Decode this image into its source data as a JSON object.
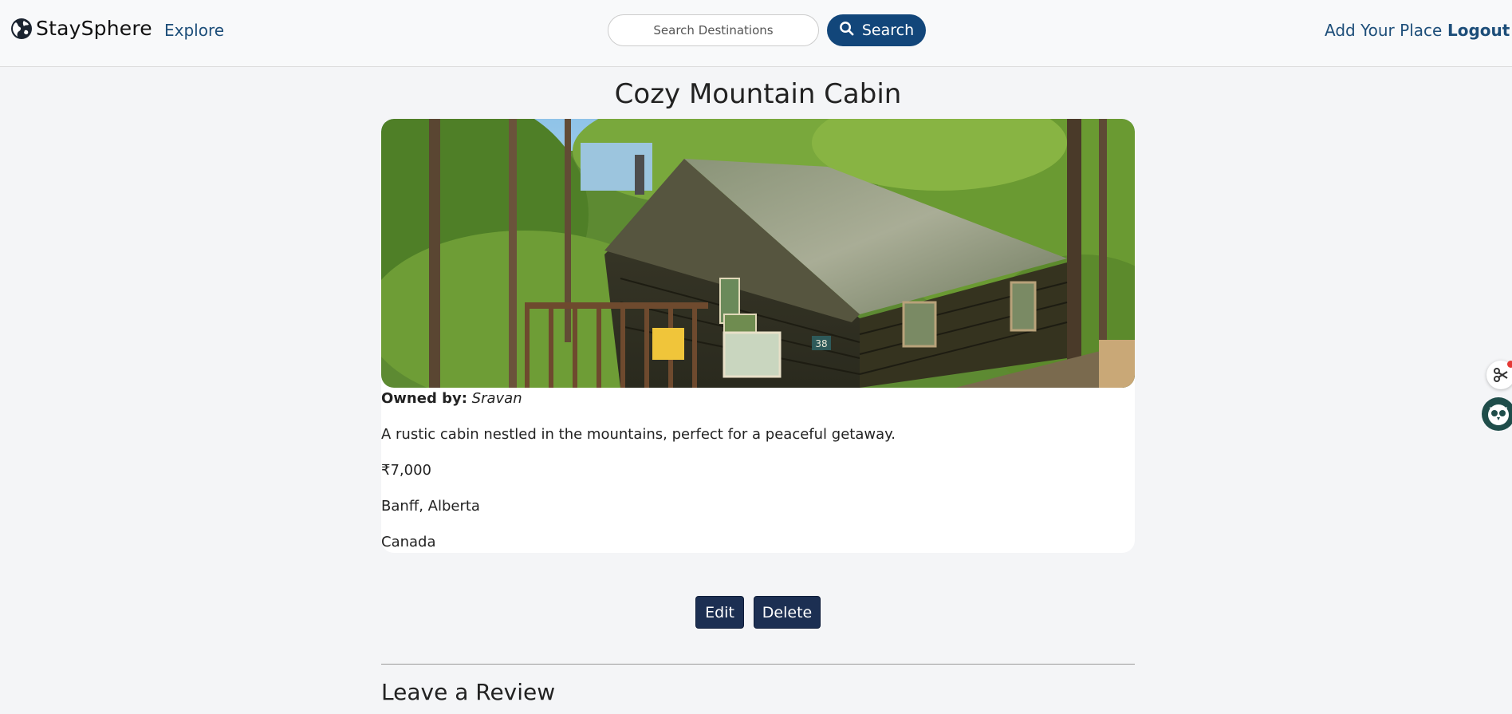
{
  "navbar": {
    "brand": "StaySphere",
    "explore": "Explore",
    "search_placeholder": "Search Destinations",
    "search_button": "Search",
    "add_place": "Add Your Place",
    "logout": "Logout"
  },
  "listing": {
    "title": "Cozy Mountain Cabin",
    "owned_label": "Owned by:",
    "owner": "Sravan",
    "description": "A rustic cabin nestled in the mountains, perfect for a peaceful getaway.",
    "price": "₹7,000",
    "location": "Banff, Alberta",
    "country": "Canada",
    "cabin_number": "38"
  },
  "actions": {
    "edit": "Edit",
    "delete": "Delete"
  },
  "review": {
    "heading": "Leave a Review"
  },
  "colors": {
    "brand_blue": "#12467a",
    "button_dark": "#1c2f52",
    "link_blue": "#1d4e79"
  }
}
